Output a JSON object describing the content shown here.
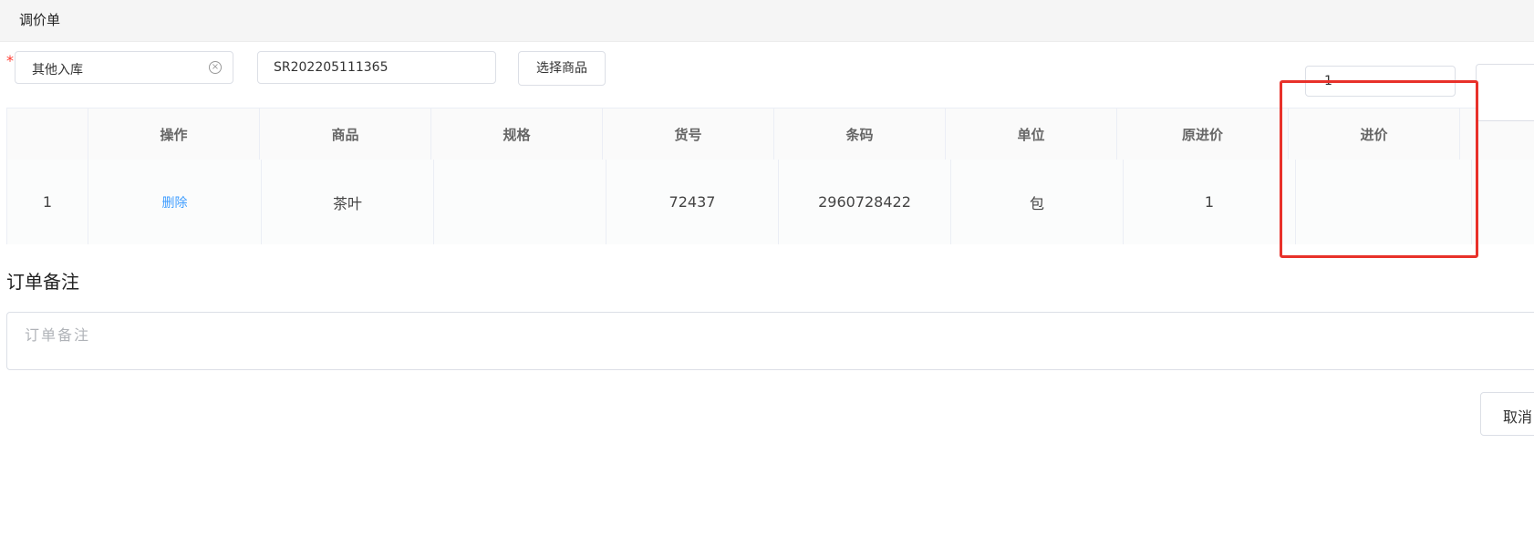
{
  "header": {
    "title": "调价单"
  },
  "form": {
    "type_select": {
      "value": "其他入库",
      "required_mark": "*"
    },
    "order_no": {
      "value": "SR202205111365"
    },
    "choose_goods_label": "选择商品"
  },
  "table": {
    "columns": [
      "",
      "操作",
      "商品",
      "规格",
      "货号",
      "条码",
      "单位",
      "原进价",
      "进价"
    ],
    "rows": [
      {
        "index": "1",
        "action": "删除",
        "goods": "茶叶",
        "spec": "",
        "item_no": "72437",
        "barcode": "2960728422",
        "unit": "包",
        "orig_price": "1",
        "price": "1"
      }
    ]
  },
  "remark": {
    "title": "订单备注",
    "placeholder": "订单备注"
  },
  "footer": {
    "cancel_label": "取消"
  },
  "colors": {
    "highlight": "#e8312a",
    "link": "#409eff",
    "required": "#ff3b30"
  }
}
